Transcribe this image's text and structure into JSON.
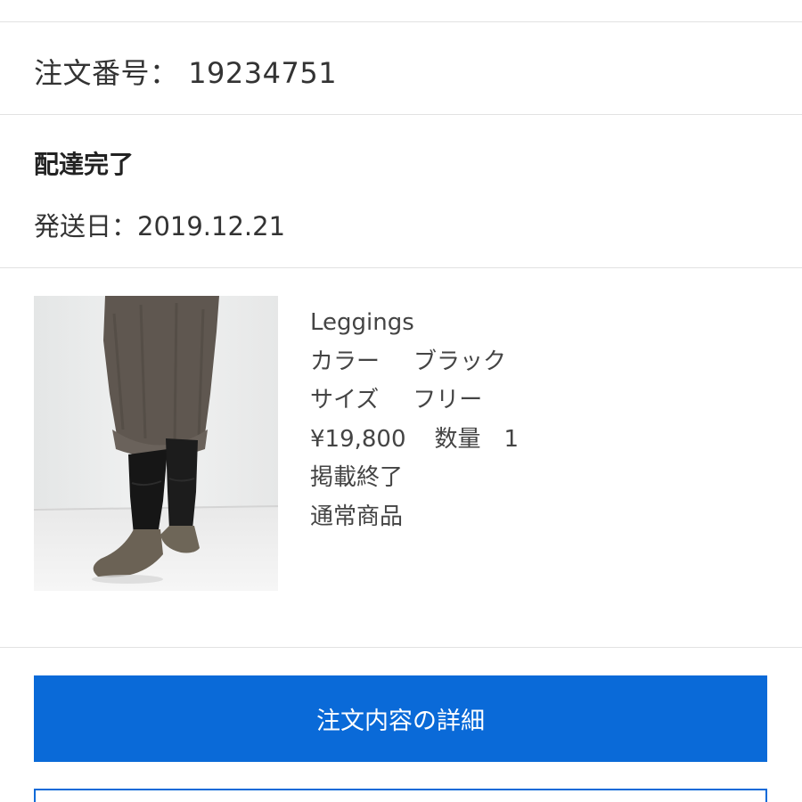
{
  "order": {
    "number_label": "注文番号：",
    "number_value": "19234751"
  },
  "status": {
    "title": "配達完了",
    "ship_date": "発送日：2019.12.21"
  },
  "product": {
    "name": "Leggings",
    "color_label": "カラー",
    "color_value": "ブラック",
    "size_label": "サイズ",
    "size_value": "フリー",
    "price": "¥19,800",
    "quantity_label": "数量",
    "quantity_value": "1",
    "listing_status": "掲載終了",
    "product_type": "通常商品"
  },
  "buttons": {
    "order_details_label": "注文内容の詳細",
    "primary_color": "#0a6ad8"
  }
}
